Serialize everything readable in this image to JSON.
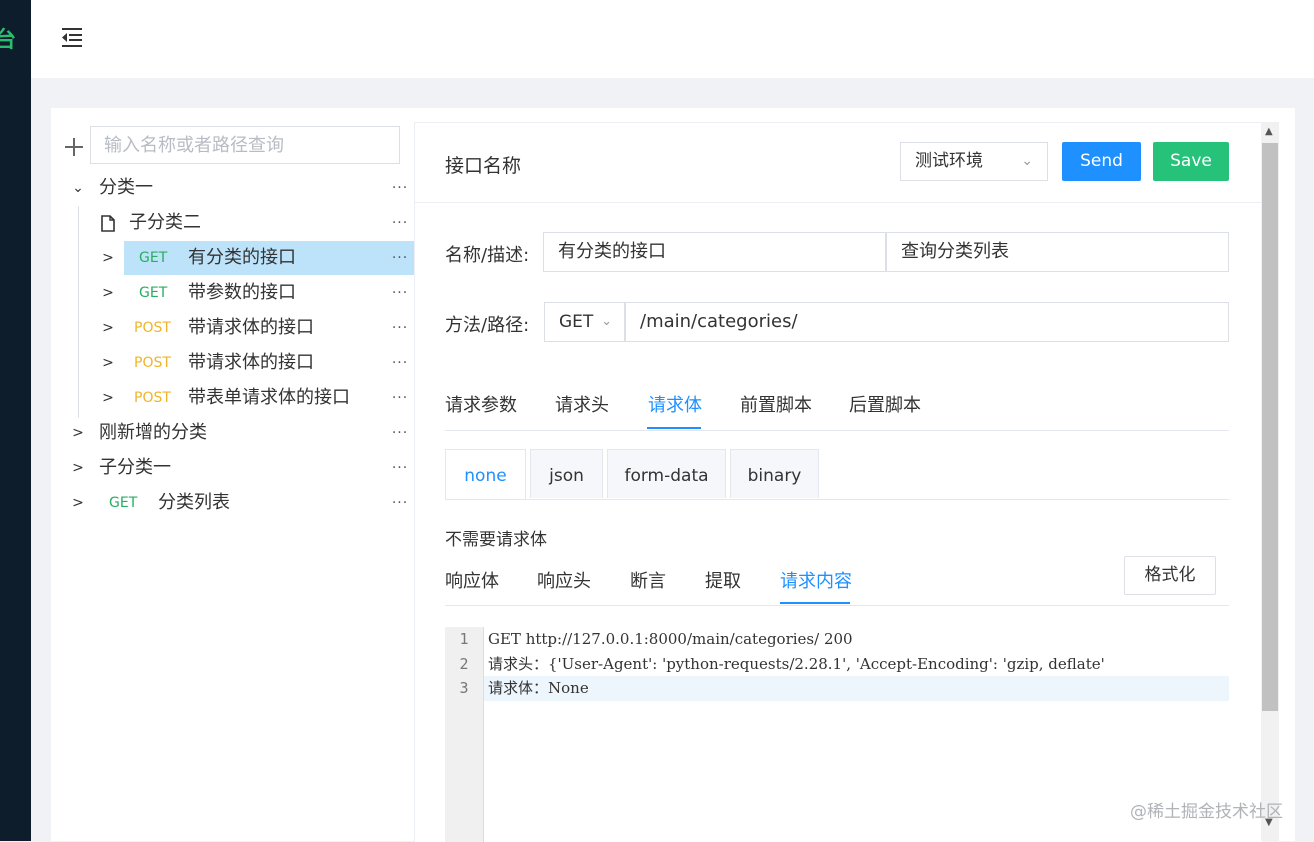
{
  "app": {
    "logo_text": "台"
  },
  "search": {
    "placeholder": "输入名称或者路径查询"
  },
  "tree": {
    "items": [
      {
        "label": "分类一",
        "method": "",
        "more": "···"
      },
      {
        "label": "子分类二",
        "method": "",
        "more": "···"
      },
      {
        "label": "有分类的接口",
        "method": "GET",
        "more": "···"
      },
      {
        "label": "带参数的接口",
        "method": "GET",
        "more": "···"
      },
      {
        "label": "带请求体的接口",
        "method": "POST",
        "more": "···"
      },
      {
        "label": "带请求体的接口",
        "method": "POST",
        "more": "···"
      },
      {
        "label": "带表单请求体的接口",
        "method": "POST",
        "more": "···"
      },
      {
        "label": "刚新增的分类",
        "method": "",
        "more": "···"
      },
      {
        "label": "子分类一",
        "method": "",
        "more": "···"
      },
      {
        "label": "分类列表",
        "method": "GET",
        "more": "···"
      }
    ]
  },
  "header": {
    "title": "接口名称",
    "env": "测试环境",
    "send_label": "Send",
    "save_label": "Save"
  },
  "form": {
    "name_label": "名称/描述:",
    "name_value": "有分类的接口",
    "desc_value": "查询分类列表",
    "path_label": "方法/路径:",
    "method": "GET",
    "path_value": "/main/categories/"
  },
  "tabs": [
    "请求参数",
    "请求头",
    "请求体",
    "前置脚本",
    "后置脚本"
  ],
  "body_tabs": [
    "none",
    "json",
    "form-data",
    "binary"
  ],
  "body_empty_text": "不需要请求体",
  "result_tabs": [
    "响应体",
    "响应头",
    "断言",
    "提取",
    "请求内容"
  ],
  "format_label": "格式化",
  "editor": {
    "line_numbers": [
      "1",
      "2",
      "3"
    ],
    "lines": [
      "GET http://127.0.0.1:8000/main/categories/ 200",
      "请求头：{'User-Agent': 'python-requests/2.28.1', 'Accept-Encoding': 'gzip, deflate'",
      "请求体：None"
    ]
  },
  "watermark": "@稀土掘金技术社区",
  "colors": {
    "accent": "#1e90ff",
    "save": "#27c27a",
    "get": "#27ae60",
    "post": "#f0b429",
    "active_row": "#bde3fb"
  }
}
